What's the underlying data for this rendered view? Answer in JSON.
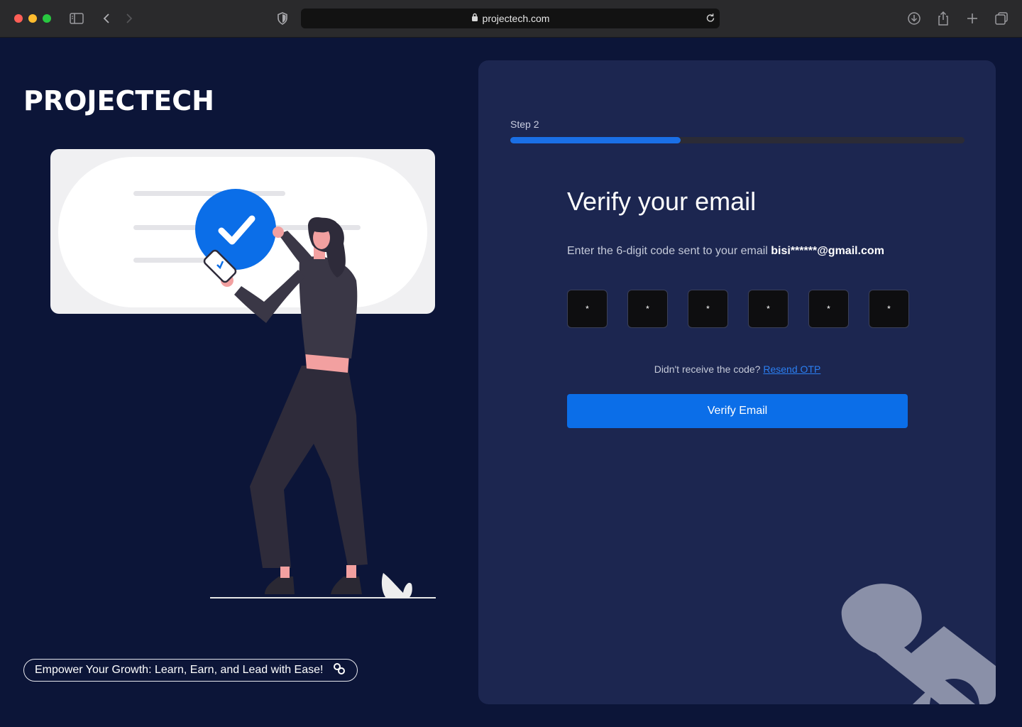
{
  "browser": {
    "url": "projectech.com"
  },
  "brand": {
    "logo_text": "PROJECTECH",
    "tagline": "Empower Your Growth: Learn, Earn, and Lead with Ease!"
  },
  "step": {
    "label": "Step 2",
    "progress_fraction": 0.375
  },
  "form": {
    "title": "Verify your email",
    "subtitle_prefix": "Enter the 6-digit code sent to your email ",
    "email": "bisi******@gmail.com",
    "otp_digits": [
      "*",
      "*",
      "*",
      "*",
      "*",
      "*"
    ],
    "resend_prompt": "Didn't receive the code? ",
    "resend_link": "Resend OTP",
    "submit_label": "Verify Email"
  },
  "colors": {
    "page_bg": "#0c1538",
    "card_bg": "#1c2650",
    "accent": "#0b6ee8",
    "progress_fill": "#1a6fe6"
  },
  "icons": {
    "sidebar": "sidebar-icon",
    "back": "chevron-left-icon",
    "forward": "chevron-right-icon",
    "shield": "shield-icon",
    "lock": "lock-icon",
    "reload": "reload-icon",
    "download": "download-icon",
    "share": "share-icon",
    "new_tab": "plus-icon",
    "tabs": "tabs-overview-icon",
    "tagline": "link-icon"
  }
}
